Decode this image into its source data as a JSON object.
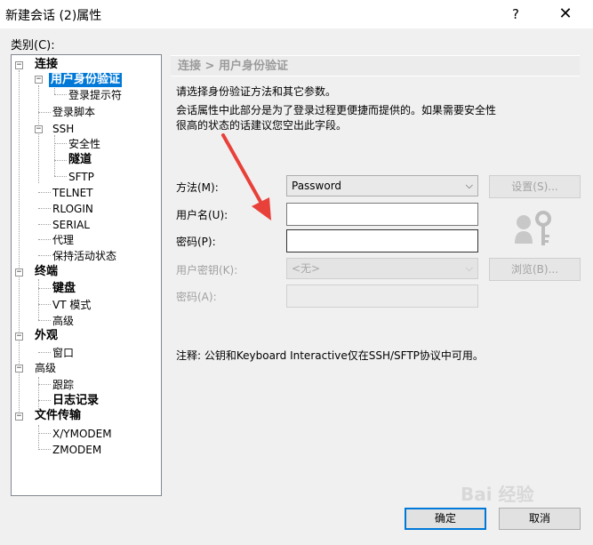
{
  "window": {
    "title": "新建会话 (2)属性",
    "help_label": "?",
    "close_label": "✕"
  },
  "category_label": "类别(C):",
  "tree": {
    "connect": "连接",
    "user_auth": "用户身份验证",
    "login_prompts": "登录提示符",
    "login_script": "登录脚本",
    "ssh": "SSH",
    "security": "安全性",
    "tunnel": "隧道",
    "sftp": "SFTP",
    "telnet": "TELNET",
    "rlogin": "RLOGIN",
    "serial": "SERIAL",
    "proxy": "代理",
    "keepalive": "保持活动状态",
    "terminal": "终端",
    "keyboard": "键盘",
    "vt_mode": "VT 模式",
    "advanced_t": "高级",
    "appearance": "外观",
    "window_item": "窗口",
    "advanced": "高级",
    "trace": "跟踪",
    "logging": "日志记录",
    "file_transfer": "文件传输",
    "xymodem": "X/YMODEM",
    "zmodem": "ZMODEM",
    "collapse_glyph": "−"
  },
  "panel": {
    "breadcrumb": "连接 > 用户身份验证",
    "desc1": "请选择身份验证方法和其它参数。",
    "desc2": "会话属性中此部分是为了登录过程更便捷而提供的。如果需要安全性",
    "desc3": "很高的状态的话建议您空出此字段。",
    "method_label": "方法(M):",
    "method_value": "Password",
    "username_label": "用户名(U):",
    "username_value": "",
    "password_label": "密码(P):",
    "password_value": "",
    "userkey_label": "用户密钥(K):",
    "userkey_value": "<无>",
    "passphrase_label": "密码(A):",
    "settings_button": "设置(S)...",
    "browse_button": "浏览(B)...",
    "note": "注释: 公钥和Keyboard Interactive仅在SSH/SFTP协议中可用。",
    "dropdown_glyph": "⌵"
  },
  "buttons": {
    "ok": "确定",
    "cancel": "取消"
  },
  "watermark": "Bai 经验",
  "colors": {
    "selection": "#0078d7",
    "annotation_arrow": "#e8413a"
  }
}
